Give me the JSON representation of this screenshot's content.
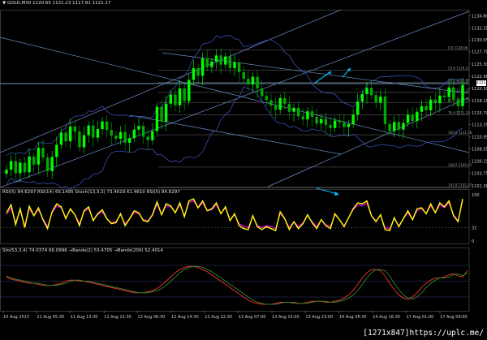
{
  "window": {
    "symbol_label": "▼ GOLD,M30",
    "ohlc": "1120.65 1121.23 1117.81 1121.17"
  },
  "watermark": "[1271x847]https://uplc.me/",
  "colors": {
    "background": "#000000",
    "bull_candle": "#00ff00",
    "bear_candle": "#00aa00",
    "rsi_line": "#ffff00",
    "rsi_signal": "#ff00ff",
    "channel_line": "#6b8fc8",
    "bands": "#3a4fb0",
    "arrow": "#00bfff",
    "grid": "#ffffff"
  },
  "chart_data": [
    {
      "type": "candlestick",
      "name": "price-panel",
      "title": "GOLD,M30",
      "ylim": [
        1101.0,
        1136.0
      ],
      "y_ticks": [
        "1134.80",
        "1132.35",
        "1130.05",
        "1127.70",
        "1125.30",
        "1122.90",
        "1120.50",
        "1118.10",
        "1115.70",
        "1113.35",
        "1110.95",
        "1108.55",
        "1106.15",
        "1103.75",
        "1101.30"
      ],
      "current_price": "1121.17",
      "fib_levels": [
        {
          "label": "0.0",
          "price": "1128.06"
        },
        {
          "label": "23.6",
          "price": "1124.12"
        },
        {
          "label": "38.2",
          "price": "1121.68"
        },
        {
          "label": "50.0",
          "price": "1119.72"
        },
        {
          "label": "61.8",
          "price": "1117.75"
        },
        {
          "label": "76.4",
          "price": "1115.32"
        },
        {
          "label": "100.0",
          "price": "1111.38"
        },
        {
          "label": "138.2",
          "price": "1105.01"
        },
        {
          "label": "161.8",
          "price": "1101.07"
        }
      ],
      "close": [
        1104.5,
        1106.2,
        1103.8,
        1105.9,
        1104.0,
        1107.1,
        1105.5,
        1108.8,
        1106.9,
        1104.2,
        1107.0,
        1109.4,
        1111.8,
        1110.1,
        1113.0,
        1112.0,
        1108.9,
        1111.3,
        1113.2,
        1110.8,
        1112.5,
        1114.0,
        1112.3,
        1111.2,
        1110.6,
        1111.9,
        1109.8,
        1110.7,
        1112.4,
        1113.1,
        1111.0,
        1110.3,
        1112.1,
        1116.9,
        1114.0,
        1117.5,
        1119.3,
        1117.2,
        1120.5,
        1118.0,
        1122.2,
        1124.5,
        1123.0,
        1126.4,
        1124.7,
        1125.8,
        1127.0,
        1125.2,
        1126.8,
        1124.5,
        1125.6,
        1123.7,
        1122.4,
        1121.3,
        1122.8,
        1120.5,
        1119.0,
        1118.2,
        1117.1,
        1116.3,
        1118.6,
        1117.5,
        1115.9,
        1116.7,
        1115.0,
        1114.4,
        1116.0,
        1114.9,
        1113.6,
        1114.5,
        1113.3,
        1112.7,
        1114.2,
        1113.8,
        1112.9,
        1113.5,
        1115.3,
        1117.9,
        1119.4,
        1120.6,
        1119.2,
        1117.7,
        1118.9,
        1113.5,
        1112.1,
        1113.9,
        1112.4,
        1113.7,
        1115.3,
        1114.1,
        1115.9,
        1117.0,
        1116.2,
        1118.3,
        1117.6,
        1119.1,
        1118.8,
        1120.7,
        1118.3,
        1117.0,
        1121.2
      ]
    },
    {
      "type": "line",
      "name": "rsi-panel",
      "title": "RSI(5) 84.6297  RSI(14) 65.1495  Stoch(13,3,3) 73.4619 61.4610  RSI(5) 84.6297",
      "ylim": [
        0,
        100
      ],
      "y_ticks": [
        "100",
        "32",
        "0"
      ],
      "series": [
        {
          "name": "RSI(5)",
          "values": [
            62,
            78,
            38,
            70,
            32,
            75,
            56,
            72,
            48,
            30,
            64,
            80,
            74,
            50,
            70,
            58,
            36,
            66,
            74,
            46,
            60,
            68,
            50,
            40,
            42,
            60,
            36,
            50,
            66,
            62,
            46,
            44,
            58,
            84,
            58,
            80,
            76,
            62,
            82,
            54,
            86,
            90,
            72,
            86,
            66,
            70,
            82,
            60,
            74,
            46,
            60,
            36,
            30,
            28,
            56,
            34,
            28,
            34,
            30,
            26,
            64,
            50,
            28,
            44,
            30,
            40,
            58,
            42,
            30,
            48,
            36,
            30,
            60,
            48,
            34,
            52,
            70,
            82,
            80,
            86,
            56,
            44,
            58,
            28,
            26,
            52,
            34,
            50,
            66,
            48,
            70,
            72,
            60,
            80,
            62,
            82,
            74,
            86,
            56,
            44,
            90
          ]
        },
        {
          "name": "RSI(14)",
          "values": [
            58,
            72,
            42,
            66,
            36,
            70,
            56,
            68,
            50,
            34,
            62,
            76,
            72,
            52,
            68,
            58,
            40,
            64,
            70,
            48,
            58,
            64,
            50,
            42,
            44,
            58,
            40,
            50,
            62,
            60,
            48,
            46,
            56,
            80,
            58,
            76,
            74,
            62,
            78,
            56,
            82,
            86,
            72,
            82,
            66,
            68,
            78,
            60,
            72,
            48,
            58,
            40,
            34,
            32,
            54,
            36,
            32,
            36,
            34,
            30,
            60,
            50,
            32,
            44,
            34,
            42,
            56,
            44,
            34,
            48,
            38,
            34,
            58,
            48,
            36,
            52,
            68,
            78,
            76,
            82,
            56,
            46,
            56,
            32,
            30,
            50,
            36,
            50,
            62,
            48,
            66,
            70,
            60,
            76,
            62,
            78,
            72,
            82,
            58,
            46,
            86
          ]
        }
      ]
    },
    {
      "type": "line",
      "name": "stoch-panel",
      "title": "Sto(53,3,4) 74.0374 66.0996  →Bands(2) 53.4705  →Bands(200) 52.4014",
      "ylim": [
        0,
        100
      ],
      "series": [
        {
          "name": "main",
          "values": [
            58,
            54,
            52,
            50,
            48,
            46,
            46,
            44,
            42,
            42,
            42,
            44,
            46,
            50,
            52,
            52,
            50,
            50,
            48,
            46,
            44,
            42,
            40,
            38,
            36,
            34,
            32,
            30,
            28,
            28,
            28,
            30,
            32,
            36,
            42,
            50,
            58,
            66,
            72,
            76,
            78,
            78,
            76,
            72,
            68,
            62,
            56,
            50,
            44,
            38,
            32,
            26,
            20,
            14,
            10,
            8,
            6,
            6,
            6,
            8,
            10,
            10,
            10,
            8,
            8,
            8,
            10,
            12,
            12,
            12,
            10,
            10,
            12,
            14,
            18,
            24,
            32,
            44,
            56,
            66,
            72,
            72,
            70,
            60,
            46,
            34,
            24,
            18,
            16,
            20,
            28,
            38,
            46,
            52,
            56,
            56,
            58,
            62,
            64,
            60,
            58,
            70
          ]
        },
        {
          "name": "signal",
          "values": [
            60,
            56,
            54,
            52,
            50,
            48,
            46,
            46,
            44,
            42,
            42,
            42,
            44,
            46,
            50,
            52,
            52,
            50,
            50,
            48,
            46,
            44,
            42,
            40,
            38,
            36,
            34,
            32,
            30,
            28,
            28,
            28,
            30,
            32,
            36,
            42,
            50,
            58,
            66,
            72,
            76,
            78,
            78,
            76,
            72,
            68,
            62,
            56,
            50,
            44,
            38,
            32,
            26,
            20,
            14,
            10,
            8,
            6,
            6,
            6,
            8,
            10,
            10,
            10,
            8,
            8,
            8,
            10,
            12,
            12,
            12,
            10,
            10,
            12,
            14,
            18,
            24,
            32,
            44,
            56,
            66,
            72,
            72,
            70,
            60,
            46,
            34,
            24,
            18,
            16,
            20,
            28,
            38,
            46,
            52,
            56,
            56,
            58,
            62,
            64,
            60,
            66
          ]
        }
      ]
    }
  ],
  "time_axis": [
    "10 Aug 2015",
    "11 Aug 05:30",
    "11 Aug 13:30",
    "11 Aug 21:30",
    "12 Aug 06:30",
    "12 Aug 14:30",
    "12 Aug 22:30",
    "13 Aug 07:00",
    "13 Aug 15:00",
    "13 Aug 23:00",
    "14 Aug 08:30",
    "14 Aug 16:30",
    "17 Aug 01:00",
    "17 Aug 09:00"
  ]
}
